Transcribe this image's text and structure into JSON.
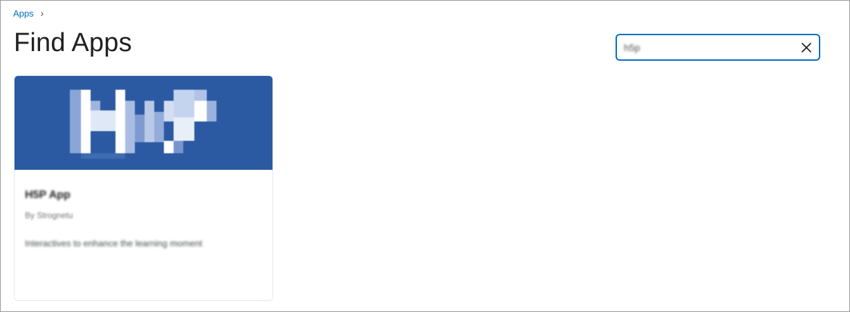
{
  "breadcrumb": {
    "root_label": "Apps",
    "separator": "›"
  },
  "page": {
    "title": "Find Apps"
  },
  "search": {
    "value": "h5p",
    "clear_icon": "close-icon"
  },
  "colors": {
    "accent": "#006fbf",
    "banner": "#2b5aa2"
  },
  "results": [
    {
      "name": "H5P App",
      "author": "By Strognetu",
      "description": "Interactives to enhance the learning moment",
      "logo_icon": "h5p-logo"
    }
  ]
}
